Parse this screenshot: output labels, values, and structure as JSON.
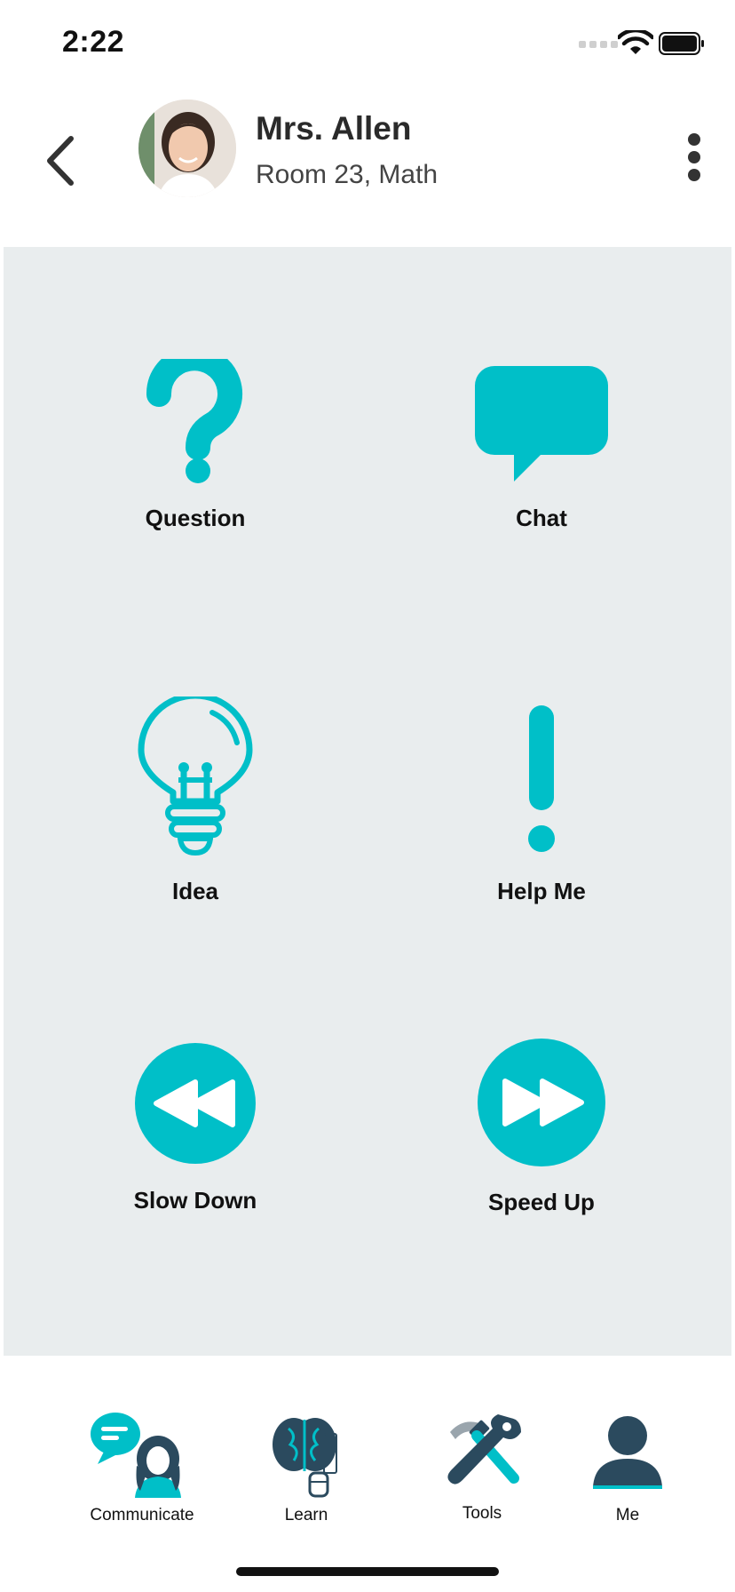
{
  "status": {
    "time": "2:22"
  },
  "header": {
    "teacher_name": "Mrs. Allen",
    "teacher_room": "Room 23, Math"
  },
  "actions": [
    {
      "label": "Question",
      "icon": "question-mark-icon"
    },
    {
      "label": "Chat",
      "icon": "speech-bubble-icon"
    },
    {
      "label": "Idea",
      "icon": "lightbulb-icon"
    },
    {
      "label": "Help Me",
      "icon": "exclamation-icon"
    },
    {
      "label": "Slow Down",
      "icon": "rewind-icon"
    },
    {
      "label": "Speed Up",
      "icon": "fast-forward-icon"
    }
  ],
  "tabs": [
    {
      "label": "Communicate",
      "icon": "communicate-icon"
    },
    {
      "label": "Learn",
      "icon": "brain-icon"
    },
    {
      "label": "Tools",
      "icon": "tools-icon"
    },
    {
      "label": "Me",
      "icon": "user-icon"
    }
  ],
  "colors": {
    "accent": "#00bfc8",
    "panel_bg": "#e9edee",
    "tab_dark": "#2b4a5e"
  }
}
